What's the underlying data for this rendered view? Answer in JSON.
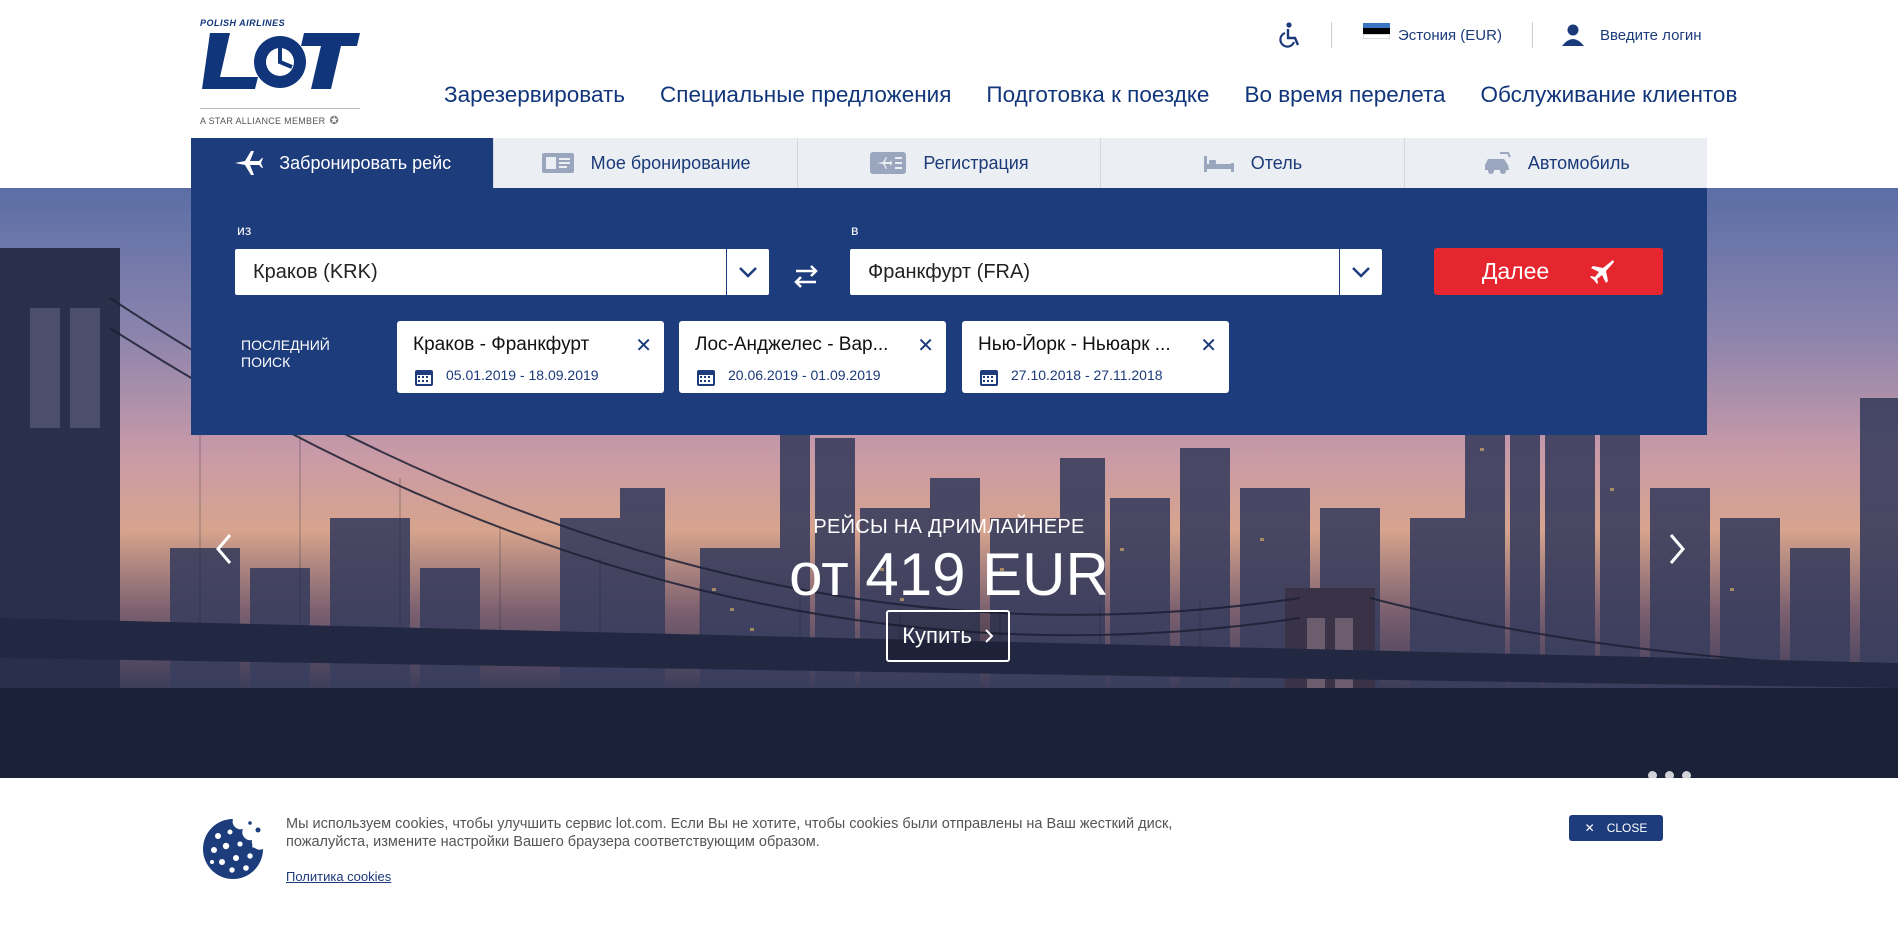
{
  "header": {
    "logo_tagline": "POLISH AIRLINES",
    "logo_text": "LOT",
    "logo_member": "A STAR ALLIANCE MEMBER",
    "region": "Эстония (EUR)",
    "login": "Введите логин",
    "nav": [
      "Зарезервировать",
      "Специальные предложения",
      "Подготовка к поездке",
      "Во время перелета",
      "Обслуживание клиентов"
    ]
  },
  "tabs": [
    {
      "label": "Забронировать рейс",
      "icon": "plane-icon"
    },
    {
      "label": "Мое бронирование",
      "icon": "ticket-icon"
    },
    {
      "label": "Регистрация",
      "icon": "boarding-pass-icon"
    },
    {
      "label": "Отель",
      "icon": "bed-icon"
    },
    {
      "label": "Автомобиль",
      "icon": "car-icon"
    }
  ],
  "search": {
    "from_label": "из",
    "from_value": "Краков (KRK)",
    "to_label": "в",
    "to_value": "Франкфурт (FRA)",
    "next_label": "Далее",
    "recent_label_line1": "ПОСЛЕДНИЙ",
    "recent_label_line2": "ПОИСК",
    "recent": [
      {
        "route": "Краков - Франкфурт",
        "dates": "05.01.2019 - 18.09.2019"
      },
      {
        "route": "Лос-Анджелес - Вар...",
        "dates": "20.06.2019 - 01.09.2019"
      },
      {
        "route": "Нью-Йорк - Ньюарк ...",
        "dates": "27.10.2018 - 27.11.2018"
      }
    ]
  },
  "promo": {
    "subtitle": "РЕЙСЫ НА ДРИМЛАЙНЕРЕ",
    "price": "от 419 EUR",
    "buy_label": "Купить"
  },
  "cookie": {
    "text": "Мы используем cookies, чтобы улучшить сервис lot.com. Если Вы не хотите, чтобы cookies были отправлены на Ваш жесткий диск, пожалуйста, измените настройки Вашего браузера соответствующим образом.",
    "policy_link": "Политика cookies",
    "close_label": "CLOSE"
  },
  "colors": {
    "brand": "#1d3c7c",
    "accent": "#e5262f"
  }
}
